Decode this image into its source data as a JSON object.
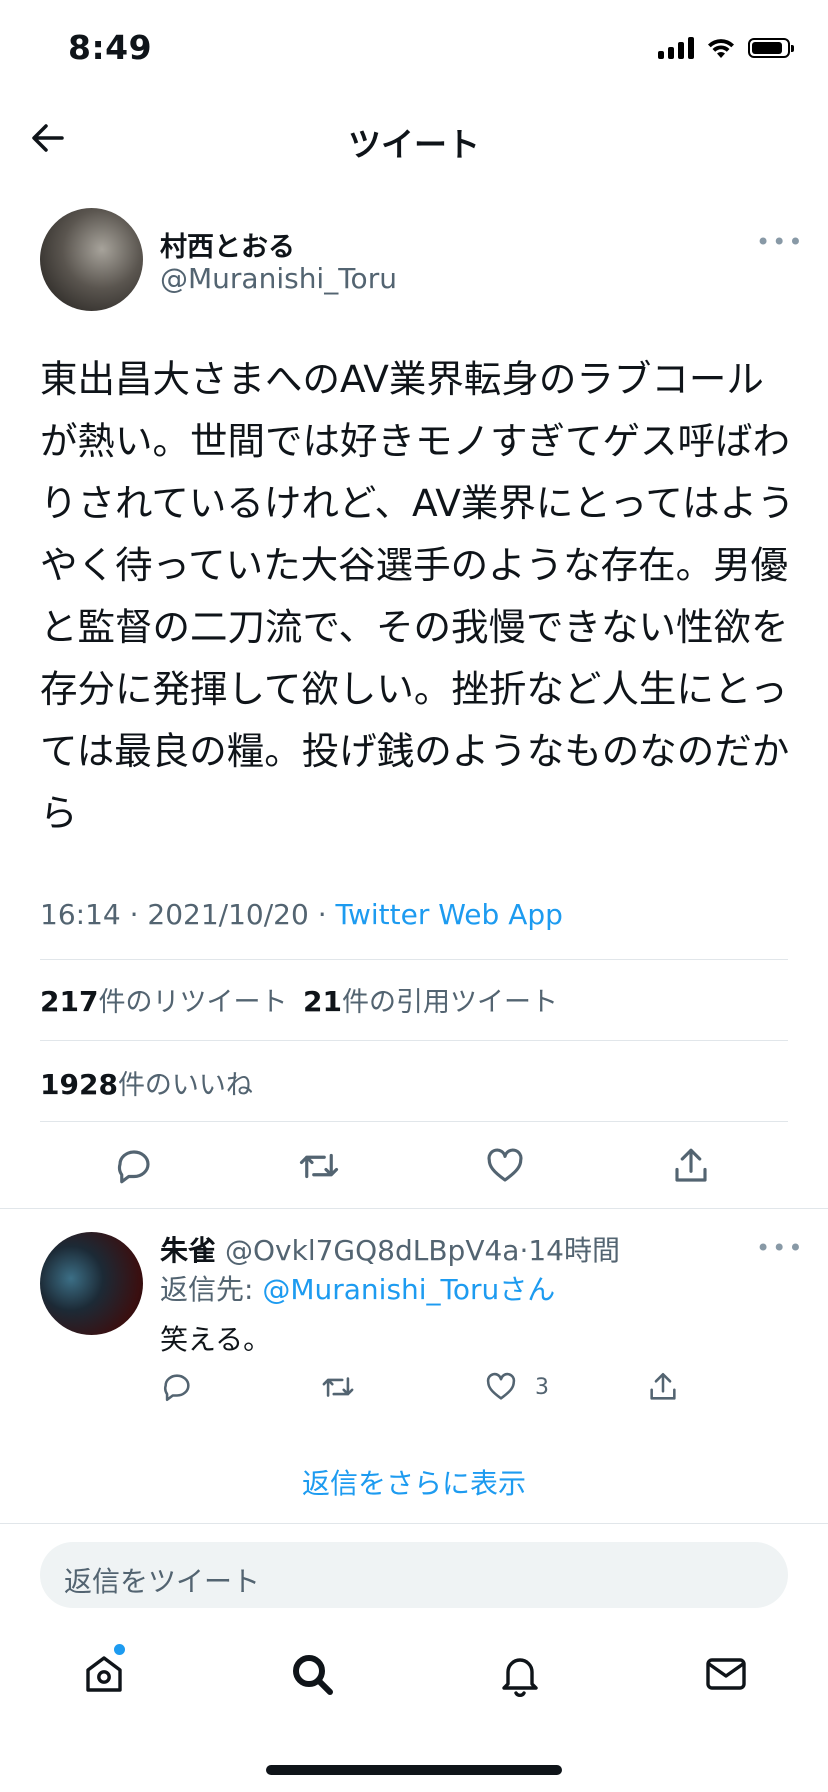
{
  "status_bar": {
    "time": "8:49"
  },
  "header": {
    "title": "ツイート",
    "back_icon": "arrow-left-icon"
  },
  "tweet": {
    "author_name": "村西とおる",
    "author_handle": "@Muranishi_Toru",
    "more_label": "•••",
    "text": "東出昌大さまへのAV業界転身のラブコールが熱い。世間では好きモノすぎてゲス呼ばわりされているけれど、AV業界にとってはようやく待っていた大谷選手のような存在。男優と監督の二刀流で、その我慢できない性欲を存分に発揮して欲しい。挫折など人生にとっては最良の糧。投げ銭のようなものなのだから",
    "time": "16:14",
    "sep1": " · ",
    "date": "2021/10/20",
    "sep2": " · ",
    "source": "Twitter Web App",
    "retweets_count": "217",
    "retweets_label": "件のリツイート",
    "quotes_count": "21",
    "quotes_label": "件の引用ツイート",
    "likes_count": "1928",
    "likes_label": "件のいいね"
  },
  "reply": {
    "name": "朱雀",
    "handle": "@Ovkl7GQ8dLBpV4a",
    "sep": "·",
    "time_ago": "14時間",
    "reply_to_prefix": "返信先: ",
    "reply_to_mention": "@Muranishi_Toru",
    "reply_to_suffix": "さん",
    "text": "笑える。",
    "like_count": "3",
    "more_label": "•••"
  },
  "show_more_replies": "返信をさらに表示",
  "compose": {
    "placeholder": "返信をツイート"
  },
  "colors": {
    "accent": "#1d9bf0",
    "text": "#0f1419",
    "secondary": "#536471",
    "divider": "#e1e6ea"
  },
  "tab_bar": [
    "home-icon",
    "search-icon",
    "notifications-icon",
    "messages-icon"
  ]
}
